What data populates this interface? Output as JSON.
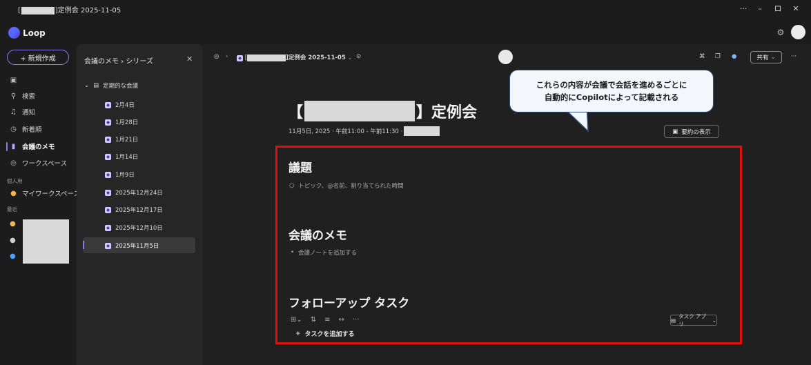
{
  "window": {
    "title_suffix": "]定例会 2025-11-05",
    "title_prefix": "[",
    "btn_more": "···",
    "btn_min": "–",
    "btn_max": "ロ",
    "btn_close": "✕"
  },
  "app": {
    "name": "Loop",
    "settings_icon": "⚙"
  },
  "leftnav": {
    "new_label": "+ 新規作成",
    "items": [
      {
        "icon": "▣",
        "label": ""
      },
      {
        "icon": "⚲",
        "label": "検索"
      },
      {
        "icon": "♫",
        "label": "通知"
      },
      {
        "icon": "◷",
        "label": "新着順"
      },
      {
        "icon": "▮",
        "label": "会議のメモ"
      },
      {
        "icon": "◎",
        "label": "ワークスペース"
      }
    ],
    "section_personal": "個人用",
    "my_workspace": "マイワークスペース",
    "section_recent": "最近"
  },
  "panel": {
    "breadcrumb": "会議のメモ  ›  シリーズ",
    "close": "✕",
    "parent": "定期的な会議",
    "pages": [
      "2月4日",
      "1月28日",
      "1月21日",
      "1月14日",
      "1月9日",
      "2025年12月24日",
      "2025年12月17日",
      "2025年12月10日",
      "2025年11月5日"
    ]
  },
  "toolbar": {
    "crumb_prefix": "[",
    "crumb_title": "]定例会 2025-11-05",
    "share_label": "共有",
    "more": "···"
  },
  "callout": {
    "line1": "これらの内容が会議で会話を進めるごとに",
    "line2": "自動的にCopilotによって記載される"
  },
  "doc": {
    "title_open": "【",
    "title_close": "】定例会",
    "meta": "11月5日, 2025 · 午前11:00 - 午前11:30 ·",
    "summary_label": "要約の表示",
    "agenda_heading": "議題",
    "agenda_placeholder": "トピック、@名前、割り当てられた時間",
    "notes_heading": "会議のメモ",
    "notes_placeholder": "会議ノートを追加する",
    "tasks_heading": "フォローアップ タスク",
    "task_app_label": "タスク アプリ",
    "add_task_label": "タスクを追加する"
  }
}
